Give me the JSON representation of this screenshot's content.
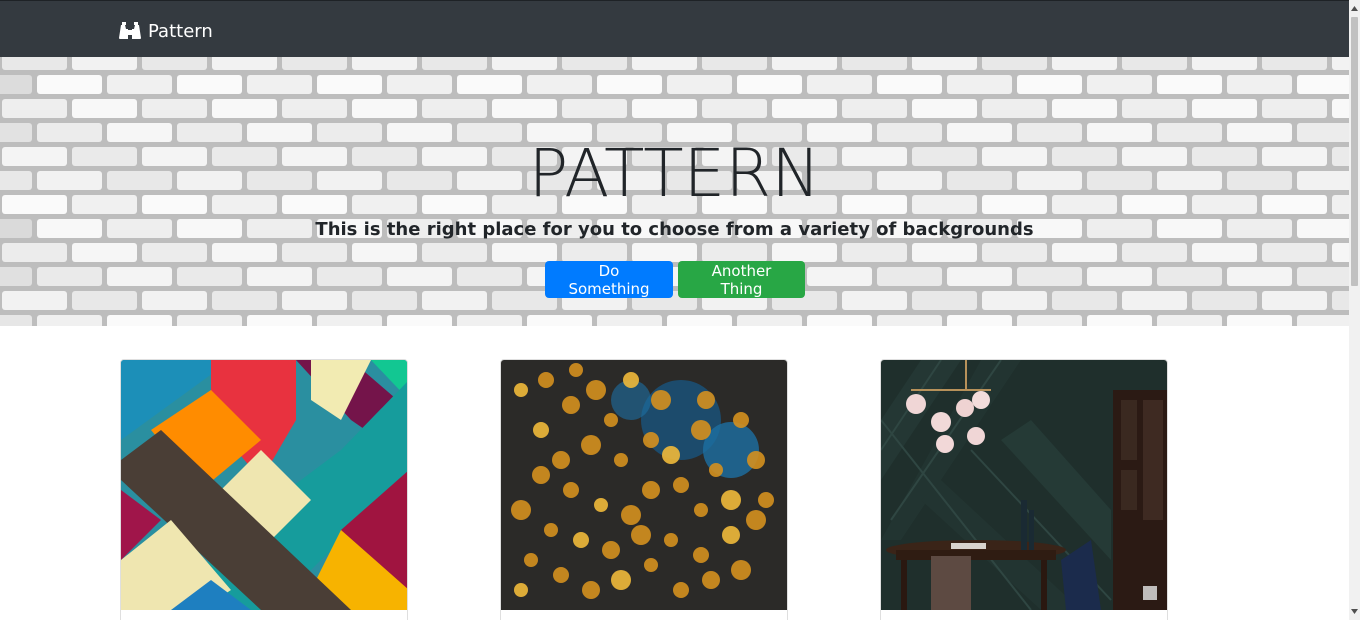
{
  "navbar": {
    "brand_label": "Pattern",
    "brand_icon": "binoculars-icon",
    "background": "#343a40"
  },
  "hero": {
    "title": "PATTERN",
    "subtitle": "This is the right place for you to choose from a variety of backgrounds",
    "buttons": [
      {
        "label": "Do Something",
        "color": "#007bff"
      },
      {
        "label": "Another Thing",
        "color": "#28a745"
      }
    ]
  },
  "cards": [
    {
      "image": "colorful-geometric-stripes-image"
    },
    {
      "image": "golden-bokeh-lights-image"
    },
    {
      "image": "dark-green-dining-room-image"
    }
  ]
}
